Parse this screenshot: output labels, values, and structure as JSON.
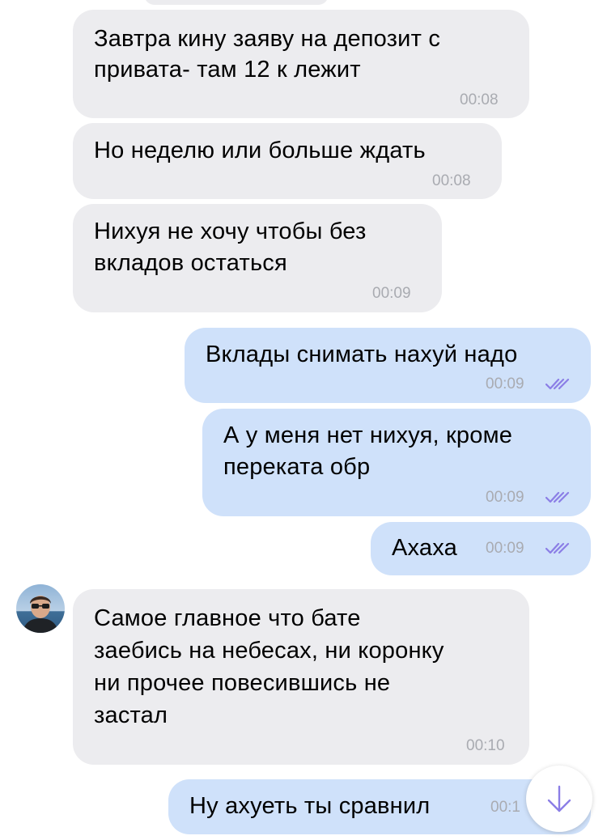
{
  "colors": {
    "incoming_bubble": "#ececef",
    "outgoing_bubble": "#cfe1fa",
    "timestamp": "#a9abb1",
    "read_check": "#8b7ee6",
    "scroll_arrow": "#8b7ee6"
  },
  "messages": [
    {
      "direction": "in",
      "lines": [
        "Завтра кину заяву на депозит с",
        "привата- там 12 к лежит"
      ],
      "time": "00:08"
    },
    {
      "direction": "in",
      "lines": [
        "Но неделю или больше ждать"
      ],
      "time": "00:08"
    },
    {
      "direction": "in",
      "lines": [
        "Нихуя не хочу чтобы без",
        "вкладов остаться"
      ],
      "time": "00:09"
    },
    {
      "direction": "out",
      "lines": [
        "Вклады снимать нахуй надо"
      ],
      "time": "00:09",
      "read": true
    },
    {
      "direction": "out",
      "lines": [
        "А у меня нет нихуя, кроме",
        "переката обр"
      ],
      "time": "00:09",
      "read": true
    },
    {
      "direction": "out",
      "lines": [
        "Ахаха"
      ],
      "time": "00:09",
      "read": true
    },
    {
      "direction": "in",
      "lines": [
        "Самое главное что бате",
        "заебись на небесах, ни коронку",
        "ни прочее повесившись не",
        "застал"
      ],
      "time": "00:10",
      "avatar": "sender-avatar"
    },
    {
      "direction": "out",
      "lines": [
        "Ну ахуеть ты сравнил"
      ],
      "time": "00:1",
      "read": true
    }
  ],
  "icons": {
    "read_receipt": "double-check-icon",
    "scroll_down": "arrow-down-icon"
  }
}
